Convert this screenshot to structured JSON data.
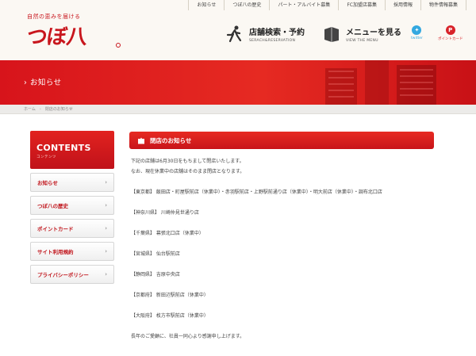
{
  "logo": {
    "tagline": "自然の恵みを届ける",
    "name": "つぼ八"
  },
  "topnav": [
    "お知らせ",
    "つぼ八の歴史",
    "パート・アルバイト募集",
    "FC加盟店募集",
    "採用情報",
    "物件情報募集"
  ],
  "banners": {
    "search": {
      "ja": "店舗検索・予約",
      "en": "SERACH&RESERVATION"
    },
    "menu": {
      "ja": "メニューを見る",
      "en": "VIEW THE MENU"
    }
  },
  "social": {
    "twitter": "twitter",
    "point": "ポイントカード"
  },
  "page_title": "お知らせ",
  "breadcrumb": {
    "home": "ホーム",
    "current": "閉店のお知らせ"
  },
  "sidebar": {
    "title": "CONTENTS",
    "subtitle": "コンテンツ",
    "items": [
      "お知らせ",
      "つぼ八の歴史",
      "ポイントカード",
      "サイト利用規約",
      "プライバシーポリシー"
    ]
  },
  "notice": {
    "title": "閉店のお知らせ",
    "intro1": "下記の店舗は6月30日をもちまして閉店いたします。",
    "intro2": "なお、現在休業中の店舗はそのまま閉店となります。",
    "lines": [
      "【東京都】 飯田店・町屋駅前店（休業中）・赤羽駅前店・上野駅前通り店（休業中）・明大前店（休業中）・調布北口店",
      "【神奈川県】 川崎仲見世通り店",
      "【千葉県】 幕張北口店（休業中）",
      "【宮城県】 仙台駅前店",
      "【静岡県】 吉原中央店",
      "【京都府】 新田辺駅前店（休業中）",
      "【大阪府】 枚方市駅前店（休業中）"
    ],
    "closing": "長年のご愛顧に、社員一同心より感謝申し上げます。"
  },
  "colors": {
    "brand_red": "#d7141b",
    "twitter": "#33a8e0"
  }
}
